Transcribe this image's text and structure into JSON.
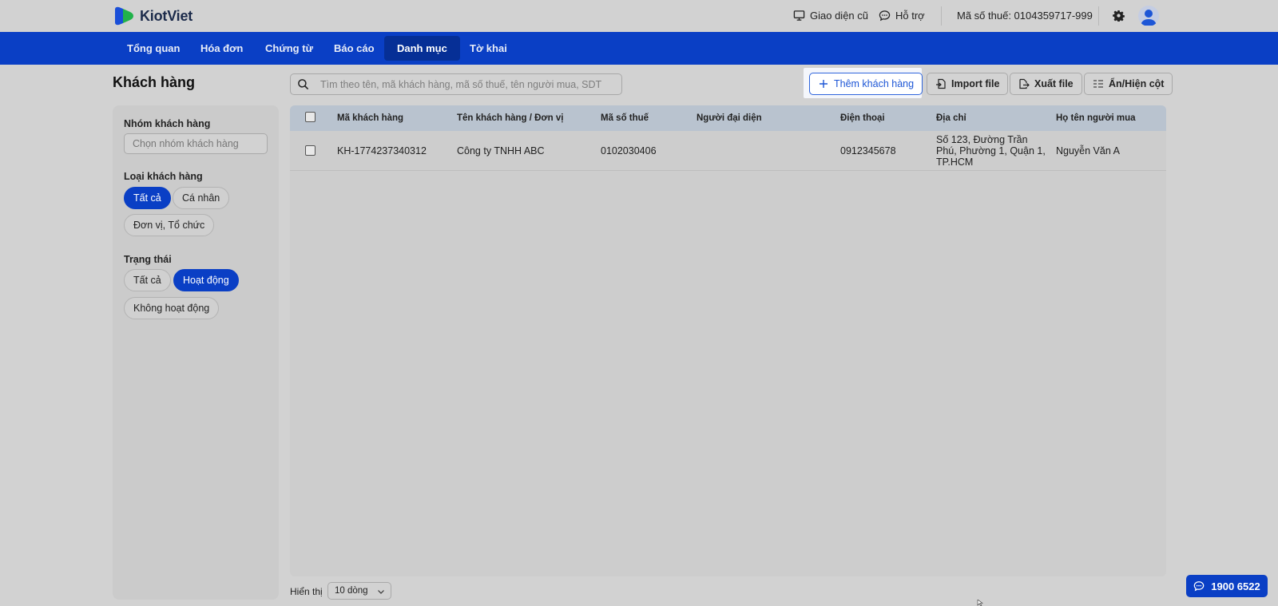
{
  "app": {
    "logo_text": "KiotViet"
  },
  "header": {
    "old_ui_label": "Giao diện cũ",
    "support_label": "Hỗ trợ",
    "tax_code_label": "Mã số thuế: 0104359717-999"
  },
  "nav": {
    "items": [
      "Tổng quan",
      "Hóa đơn",
      "Chứng từ",
      "Báo cáo",
      "Danh mục",
      "Tờ khai"
    ],
    "active": "Danh mục"
  },
  "page": {
    "title": "Khách hàng"
  },
  "filters": {
    "group_label": "Nhóm khách hàng",
    "group_placeholder": "Chọn nhóm khách hàng",
    "type_label": "Loại khách hàng",
    "type_options": [
      "Tất cả",
      "Cá nhân",
      "Đơn vị, Tổ chức"
    ],
    "type_selected": "Tất cả",
    "status_label": "Trạng thái",
    "status_options": [
      "Tất cả",
      "Hoạt động",
      "Không hoạt động"
    ],
    "status_selected": "Hoạt động"
  },
  "search": {
    "placeholder": "Tìm theo tên, mã khách hàng, mã số thuế, tên người mua, SDT"
  },
  "toolbar": {
    "add_label": "Thêm khách hàng",
    "import_label": "Import file",
    "export_label": "Xuất file",
    "columns_label": "Ẩn/Hiện cột"
  },
  "table": {
    "columns": [
      "Mã khách hàng",
      "Tên khách hàng / Đơn vị",
      "Mã số thuế",
      "Người đại diện",
      "Điện thoại",
      "Địa chỉ",
      "Họ tên người mua"
    ],
    "rows": [
      {
        "code": "KH-1774237340312",
        "name": "Công ty TNHH ABC",
        "tax": "0102030406",
        "representative": "",
        "phone": "0912345678",
        "address": [
          "Số 123, Đường Trần",
          "Phú, Phường 1, Quận 1,",
          "TP.HCM"
        ],
        "buyer": "Nguyễn Văn A"
      }
    ]
  },
  "footer": {
    "rows_label": "Hiển thị",
    "rows_value": "10 dòng",
    "hotline": "1900 6522"
  },
  "colors": {
    "brand": "#0a3fc5",
    "nav_active": "#062f96"
  }
}
